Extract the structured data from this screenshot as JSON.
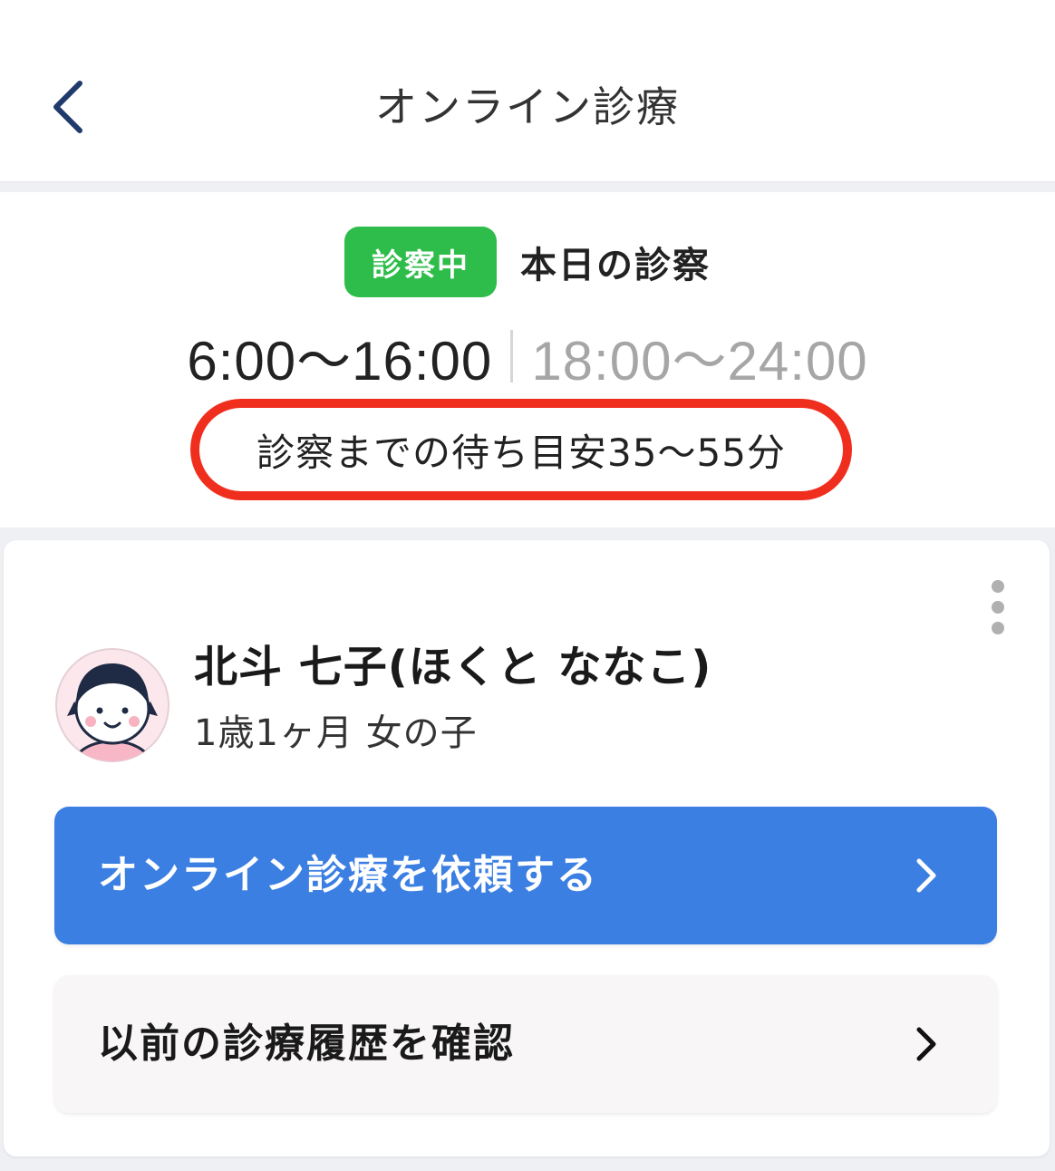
{
  "header": {
    "title": "オンライン診療",
    "back_icon": "chevron-left-icon"
  },
  "status": {
    "badge": "診察中",
    "label": "本日の診察",
    "badge_color": "#2ebd4a",
    "hours_active": "6:00〜16:00",
    "hours_inactive": "18:00〜24:00",
    "wait_estimate": "診察までの待ち目安35〜55分",
    "highlight_color": "#f02e1e"
  },
  "patient": {
    "name": "北斗 七子(ほくと ななこ)",
    "meta": "1歳1ヶ月 女の子",
    "avatar_icon": "girl-avatar-icon",
    "menu_icon": "more-vertical-icon"
  },
  "actions": {
    "request_label": "オンライン診療を依頼する",
    "history_label": "以前の診療履歴を確認",
    "primary_color": "#3b7fe2"
  }
}
